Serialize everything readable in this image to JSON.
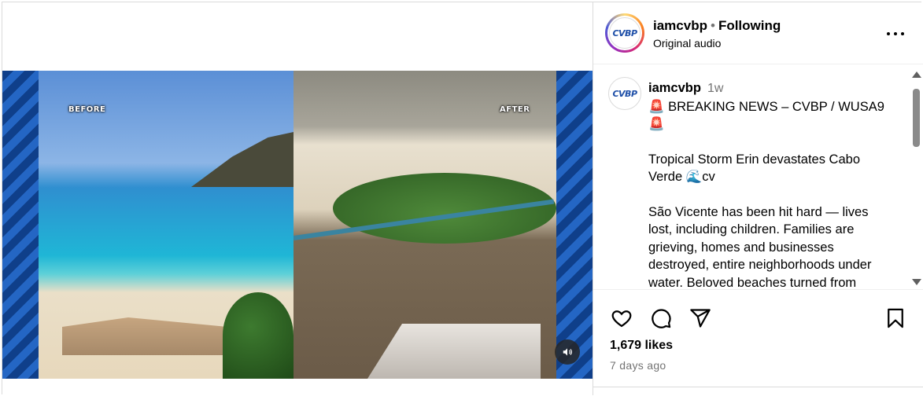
{
  "post": {
    "username": "iamcvbp",
    "follow_status": "Following",
    "separator": "•",
    "audio": "Original audio",
    "avatar_text": "CVBP"
  },
  "media": {
    "before_label": "BEFORE",
    "after_label": "AFTER",
    "mute_icon": "speaker-icon"
  },
  "caption": {
    "username": "iamcvbp",
    "time": "1w",
    "lines": [
      "🚨 BREAKING NEWS – CVBP / WUSA9",
      "🚨",
      "",
      "Tropical Storm Erin devastates Cabo",
      "Verde 🌊cv",
      "",
      "São Vicente has been hit hard — lives",
      "lost, including children. Families are",
      "grieving, homes and businesses",
      "destroyed, entire neighborhoods under",
      "water. Beloved beaches turned from"
    ]
  },
  "engagement": {
    "likes": "1,679 likes",
    "posted": "7 days ago"
  },
  "icons": {
    "like": "heart-icon",
    "comment": "comment-icon",
    "share": "share-icon",
    "save": "bookmark-icon",
    "more": "more-icon"
  }
}
